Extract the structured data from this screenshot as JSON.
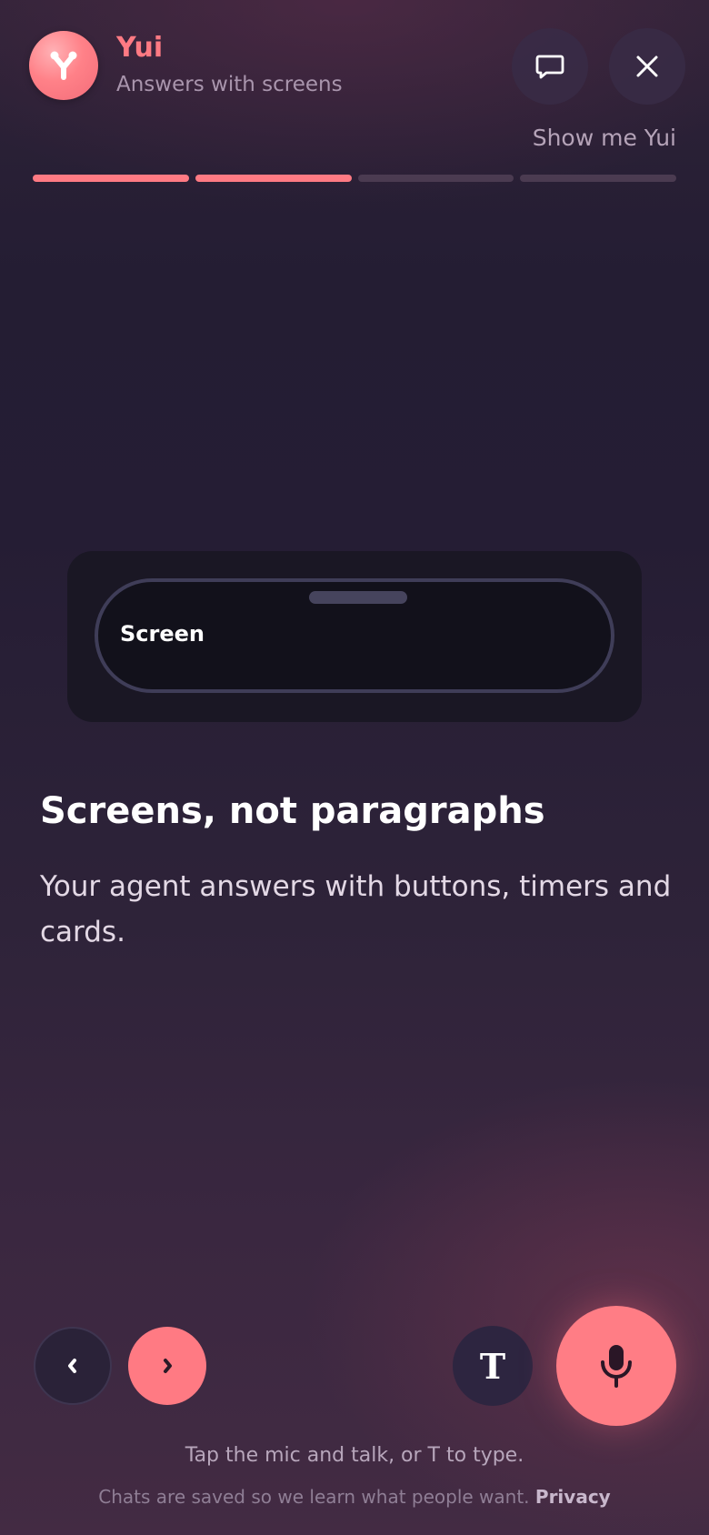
{
  "header": {
    "app_name": "Yui",
    "subtitle": "Answers with screens",
    "avatar_icon": "yui-logo",
    "chat_icon": "chat-bubble-icon",
    "close_icon": "close-icon"
  },
  "onboarding": {
    "skip_label": "Show me Yui",
    "progress": {
      "total_steps": 4,
      "current_step": 2
    }
  },
  "preview": {
    "screen_label": "Screen"
  },
  "content": {
    "headline": "Screens, not paragraphs",
    "body": "Your agent answers with buttons, timers and cards."
  },
  "controls": {
    "prev_glyph": "‹",
    "next_glyph": "›",
    "type_label": "T",
    "mic_icon": "microphone-icon"
  },
  "hint": "Tap the mic and talk, or T to type.",
  "footer": {
    "notice": "Chats are saved so we learn what people want.",
    "privacy_link": "Privacy"
  },
  "colors": {
    "accent": "#ff7a83",
    "background_top": "#2f2338",
    "background_bottom": "#432b43",
    "inactive_progress": "#4b3b51"
  }
}
